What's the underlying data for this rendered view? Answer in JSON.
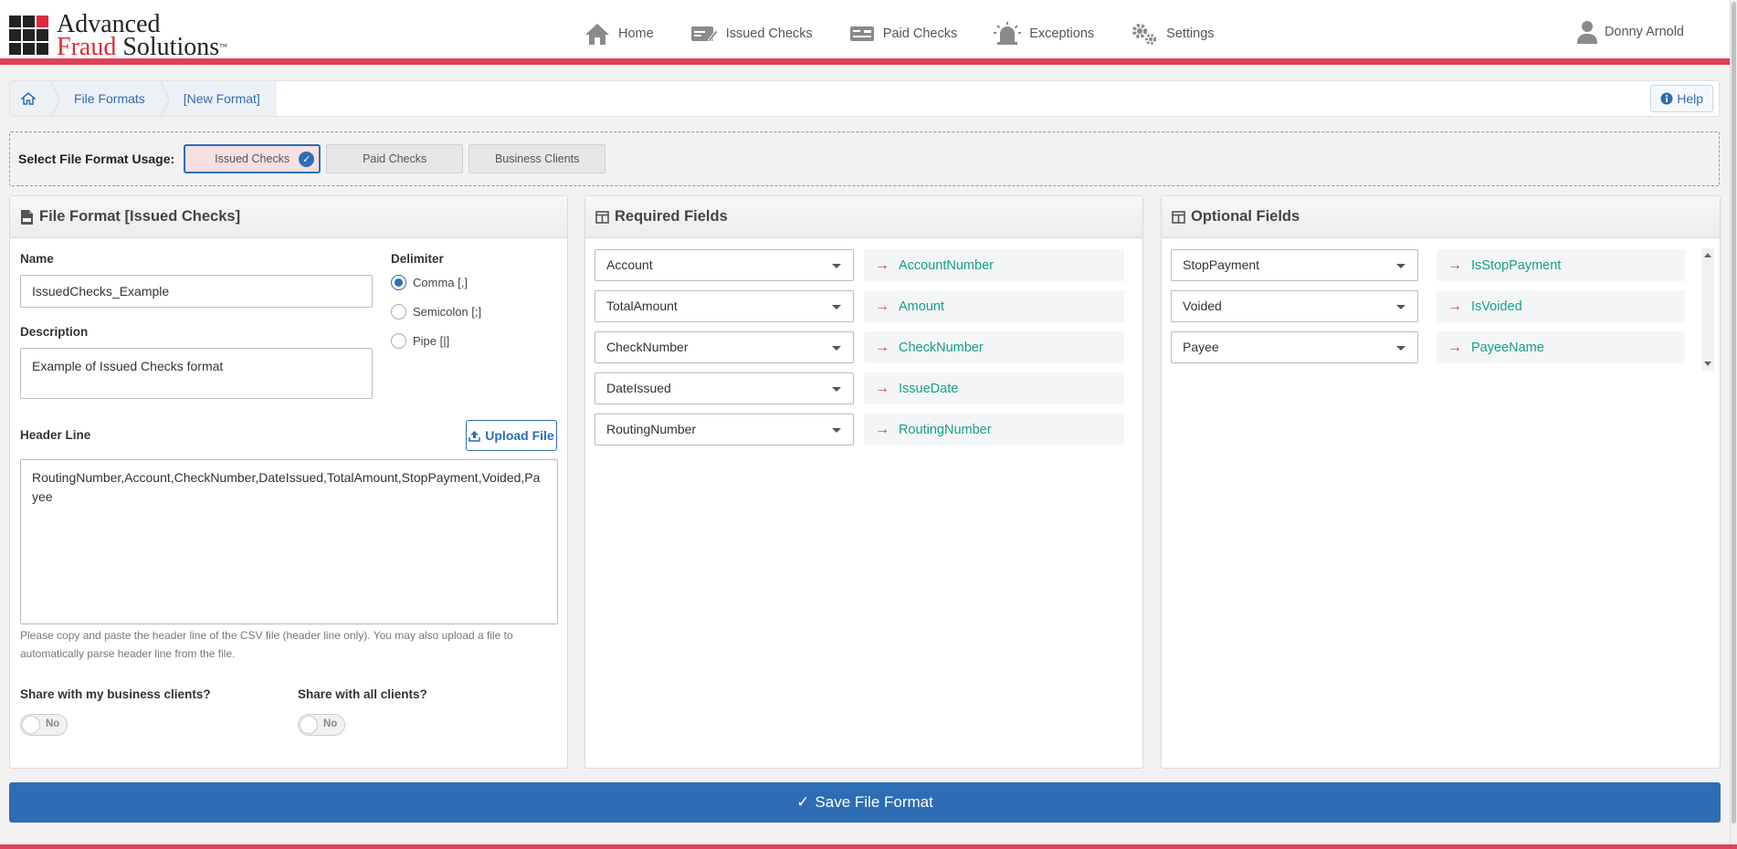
{
  "brand": {
    "line1": "Advanced",
    "line2a": "Fraud",
    "line2b": "Solutions",
    "tm": "™"
  },
  "nav": [
    {
      "label": "Home",
      "icon": "home-icon"
    },
    {
      "label": "Issued Checks",
      "icon": "issued-checks-icon"
    },
    {
      "label": "Paid Checks",
      "icon": "paid-checks-icon"
    },
    {
      "label": "Exceptions",
      "icon": "alarm-icon"
    },
    {
      "label": "Settings",
      "icon": "gear-icon"
    }
  ],
  "user": {
    "name": "Donny Arnold",
    "icon": "user-icon"
  },
  "breadcrumb": {
    "home_icon": "home-icon",
    "items": [
      "File Formats",
      "[New Format]"
    ]
  },
  "help": {
    "label": "Help",
    "icon": "info-icon"
  },
  "usage": {
    "label": "Select File Format Usage:",
    "options": [
      "Issued Checks",
      "Paid Checks",
      "Business Clients"
    ],
    "selected": "Issued Checks"
  },
  "file_format": {
    "title": "File Format [Issued Checks]",
    "icon": "csv-file-icon",
    "name_label": "Name",
    "name_value": "IssuedChecks_Example",
    "description_label": "Description",
    "description_value": "Example of Issued Checks format",
    "delimiter_label": "Delimiter",
    "delimiters": [
      "Comma [,]",
      "Semicolon [;]",
      "Pipe [|]"
    ],
    "delimiter_selected": "Comma [,]",
    "header_label": "Header Line",
    "upload_label": "Upload File",
    "header_value": "RoutingNumber,Account,CheckNumber,DateIssued,TotalAmount,StopPayment,Voided,Payee",
    "hint": "Please copy and paste the header line of the CSV file (header line only). You may also upload a file to automatically parse header line from the file.",
    "share_business_label": "Share with my business clients?",
    "share_business_value": "No",
    "share_all_label": "Share with all clients?",
    "share_all_value": "No"
  },
  "required_fields": {
    "title": "Required Fields",
    "icon": "table-icon",
    "rows": [
      {
        "source": "Account",
        "target": "AccountNumber"
      },
      {
        "source": "TotalAmount",
        "target": "Amount"
      },
      {
        "source": "CheckNumber",
        "target": "CheckNumber"
      },
      {
        "source": "DateIssued",
        "target": "IssueDate"
      },
      {
        "source": "RoutingNumber",
        "target": "RoutingNumber"
      }
    ]
  },
  "optional_fields": {
    "title": "Optional Fields",
    "icon": "table-icon",
    "rows": [
      {
        "source": "StopPayment",
        "target": "IsStopPayment"
      },
      {
        "source": "Voided",
        "target": "IsVoided"
      },
      {
        "source": "Payee",
        "target": "PayeeName"
      }
    ]
  },
  "save": {
    "label": "Save File Format",
    "icon": "check-icon"
  },
  "colors": {
    "accent": "#2e6db5",
    "brand_red": "#e0405a",
    "target_text": "#16a085"
  }
}
